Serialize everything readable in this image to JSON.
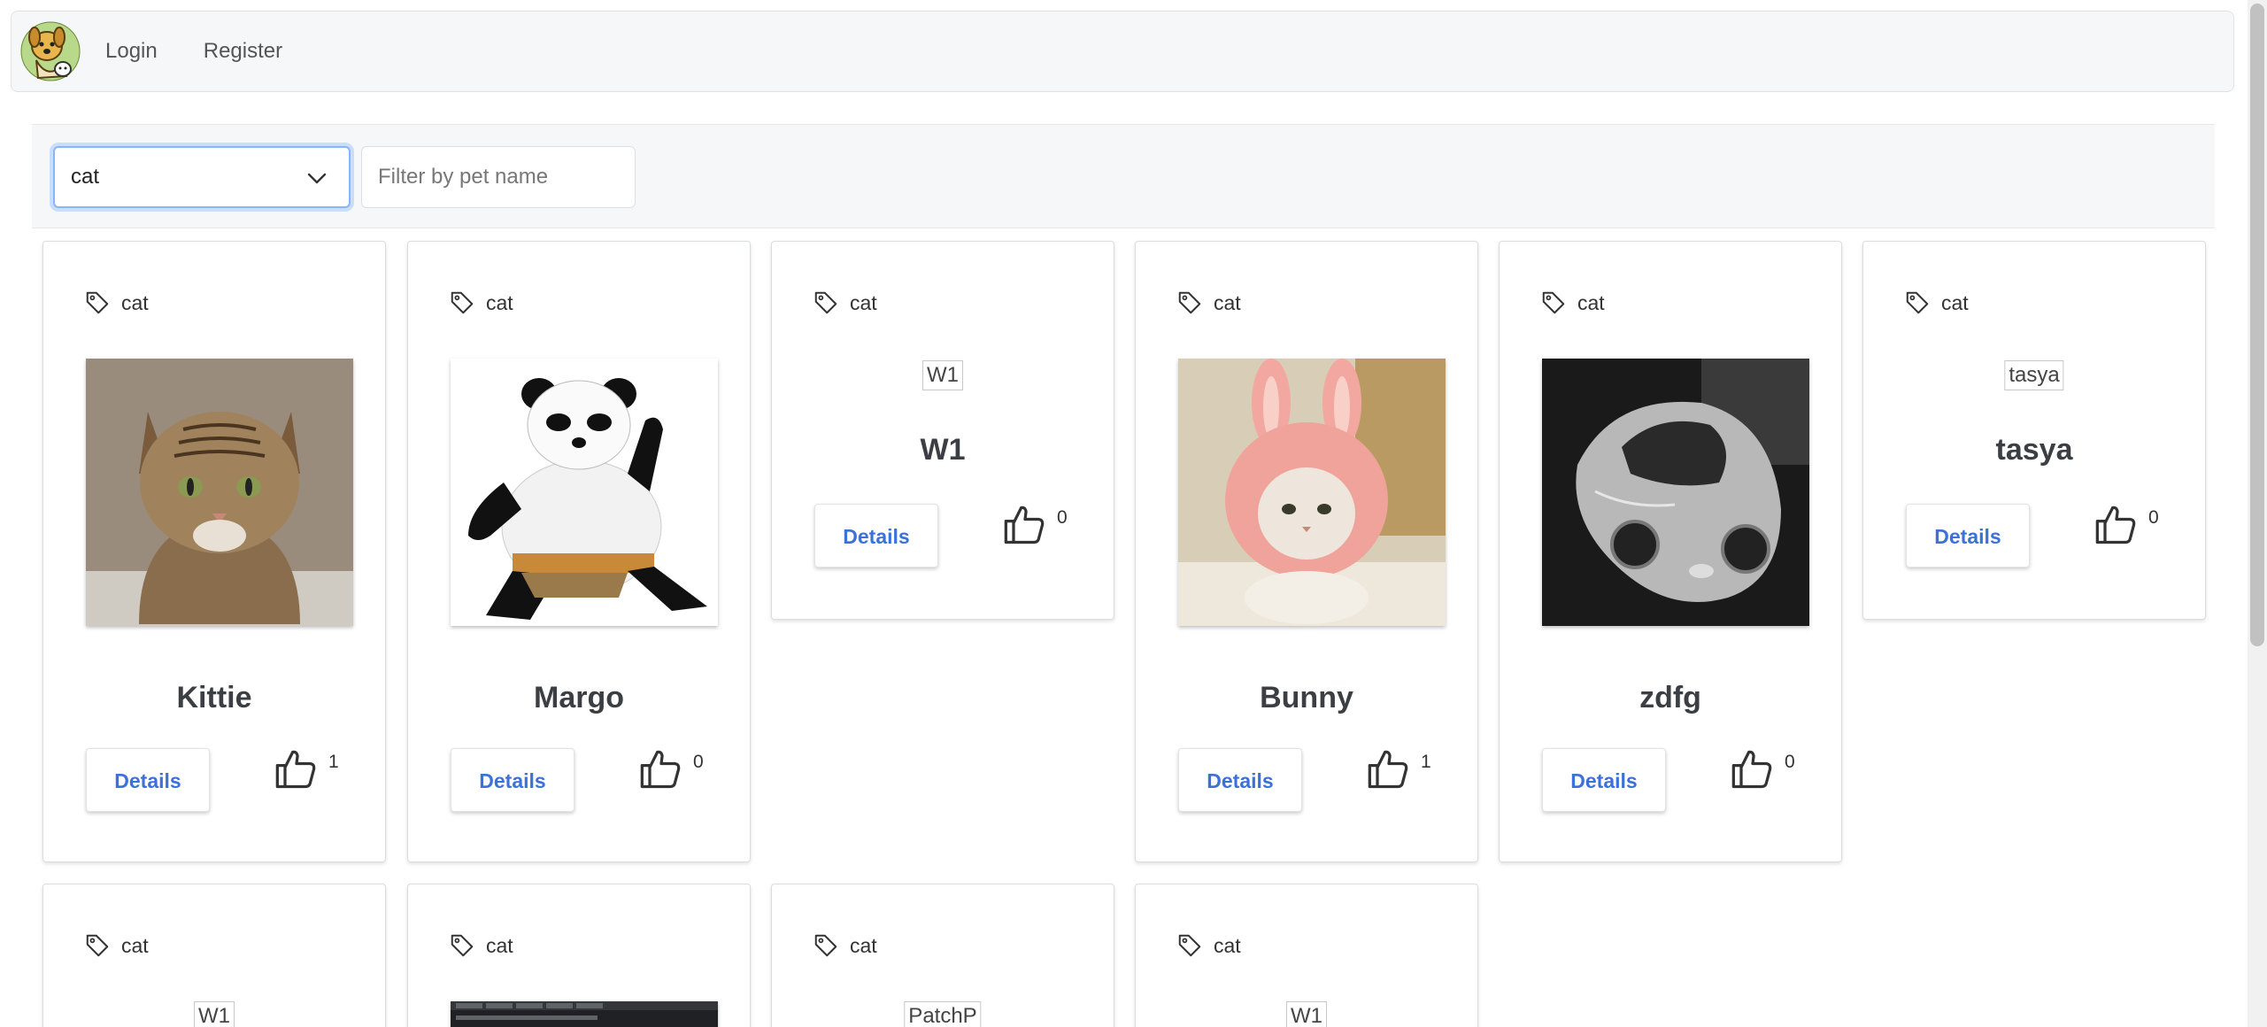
{
  "nav": {
    "login_label": "Login",
    "register_label": "Register"
  },
  "filter": {
    "selected_type": "cat",
    "name_placeholder": "Filter by pet name"
  },
  "cards": [
    {
      "tag": "cat",
      "name": "Kittie",
      "likes": "1",
      "details_label": "Details",
      "image": "photo-tabby-cat"
    },
    {
      "tag": "cat",
      "name": "Margo",
      "likes": "0",
      "details_label": "Details",
      "image": "photo-panda"
    },
    {
      "tag": "cat",
      "name": "W1",
      "likes": "0",
      "details_label": "Details",
      "alt": "W1"
    },
    {
      "tag": "cat",
      "name": "Bunny",
      "likes": "1",
      "details_label": "Details",
      "image": "photo-cat-bunny-hat"
    },
    {
      "tag": "cat",
      "name": "zdfg",
      "likes": "0",
      "details_label": "Details",
      "image": "photo-silver-car"
    },
    {
      "tag": "cat",
      "name": "tasya",
      "likes": "0",
      "details_label": "Details",
      "alt": "tasya"
    },
    {
      "tag": "cat",
      "alt": "W1"
    },
    {
      "tag": "cat",
      "image": "photo-browser-screenshot"
    },
    {
      "tag": "cat",
      "alt": "PatchP"
    },
    {
      "tag": "cat",
      "alt": "W1"
    }
  ],
  "colors": {
    "accent": "#3c72d8",
    "navbar_bg": "#f6f7f8",
    "select_focus": "#86b7fe"
  }
}
